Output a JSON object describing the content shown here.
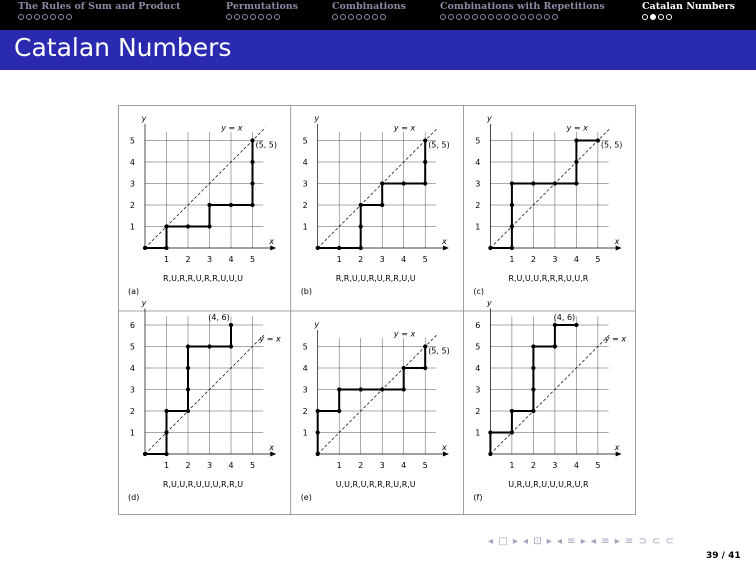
{
  "navbar": {
    "sections": [
      {
        "label": "The Rules of Sum and Product",
        "dots": 7,
        "current": -1
      },
      {
        "label": "Permutations",
        "dots": 7,
        "current": -1
      },
      {
        "label": "Combinations",
        "dots": 7,
        "current": -1
      },
      {
        "label": "Combinations with Repetitions",
        "dots": 15,
        "current": -1
      },
      {
        "label": "Catalan Numbers",
        "dots": 4,
        "current": 1
      }
    ],
    "active_index": 4
  },
  "frame": {
    "title": "Catalan Numbers"
  },
  "figure": {
    "panels": [
      {
        "tag": "(a)",
        "caption": "R,U,R,R,U,R,R,U,U,U",
        "xmax": 5,
        "ymax": 5,
        "x_labels": [
          "1",
          "2",
          "3",
          "4",
          "5"
        ],
        "y_labels": [
          "1",
          "2",
          "3",
          "4",
          "5"
        ],
        "diag_label": "y = x",
        "end_label": "(5, 5)",
        "path": "RURRURRUUU"
      },
      {
        "tag": "(b)",
        "caption": "R,R,U,U,R,U,R,R,U,U",
        "xmax": 5,
        "ymax": 5,
        "x_labels": [
          "1",
          "2",
          "3",
          "4",
          "5"
        ],
        "y_labels": [
          "1",
          "2",
          "3",
          "4",
          "5"
        ],
        "diag_label": "y = x",
        "end_label": "(5, 5)",
        "path": "RRUURURRUU"
      },
      {
        "tag": "(c)",
        "caption": "R,U,U,U,R,R,R,U,U,R",
        "xmax": 5,
        "ymax": 5,
        "x_labels": [
          "1",
          "2",
          "3",
          "4",
          "5"
        ],
        "y_labels": [
          "1",
          "2",
          "3",
          "4",
          "5"
        ],
        "diag_label": "y = x",
        "end_label": "(5, 5)",
        "path": "RUUURRRUUR"
      },
      {
        "tag": "(d)",
        "caption": "R,U,U,R,U,U,U,R,R,U",
        "xmax": 5,
        "ymax": 6,
        "x_labels": [
          "1",
          "2",
          "3",
          "4",
          "5"
        ],
        "y_labels": [
          "1",
          "2",
          "3",
          "4",
          "5",
          "6"
        ],
        "diag_label": "y = x",
        "end_label": "(4, 6)",
        "path": "RUURUUURRU"
      },
      {
        "tag": "(e)",
        "caption": "U,U,R,U,R,R,R,U,R,U",
        "xmax": 5,
        "ymax": 5,
        "x_labels": [
          "1",
          "2",
          "3",
          "4",
          "5"
        ],
        "y_labels": [
          "1",
          "2",
          "3",
          "4",
          "5"
        ],
        "diag_label": "y = x",
        "end_label": "(5, 5)",
        "path": "UURURRRURU"
      },
      {
        "tag": "(f)",
        "caption": "U,R,U,R,U,U,U,R,U,R",
        "xmax": 5,
        "ymax": 6,
        "x_labels": [
          "1",
          "2",
          "3",
          "4",
          "5"
        ],
        "y_labels": [
          "1",
          "2",
          "3",
          "4",
          "5",
          "6"
        ],
        "diag_label": "y = x",
        "end_label": "(4, 6)",
        "path": "URURUUURUR"
      }
    ],
    "axis_x": "x",
    "axis_y": "y"
  },
  "footer": {
    "nav_symbols": "◂ □ ▸ ◂ ⊡ ▸ ◂ ≡ ▸ ◂ ≡ ▸  ≡  ⊃ ⊂ ⊂",
    "page": "39 / 41"
  }
}
